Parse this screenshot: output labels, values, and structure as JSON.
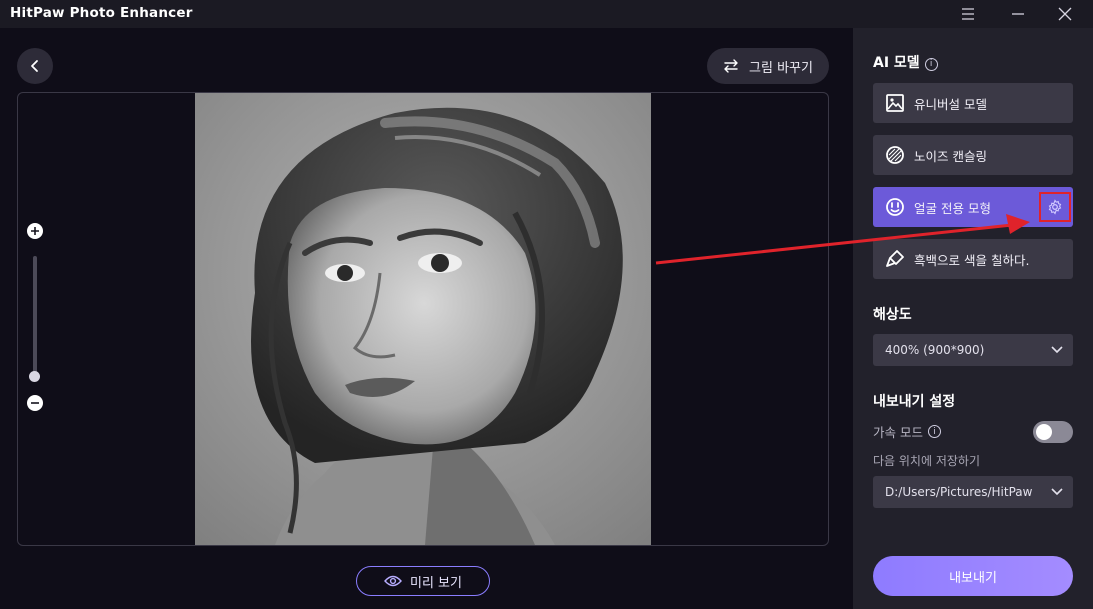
{
  "app": {
    "title": "HitPaw Photo Enhancer"
  },
  "toolbar": {
    "replace_label": "그림 바꾸기"
  },
  "preview": {
    "label": "미리 보기"
  },
  "ai_model": {
    "title": "AI 모델",
    "models": [
      {
        "label": "유니버설 모델",
        "icon": "image-icon",
        "active": false
      },
      {
        "label": "노이즈 캔슬링",
        "icon": "noise-icon",
        "active": false
      },
      {
        "label": "얼굴 전용 모형",
        "icon": "face-icon",
        "active": true
      },
      {
        "label": "흑백으로 색을 칠하다.",
        "icon": "brush-icon",
        "active": false
      }
    ]
  },
  "resolution": {
    "title": "해상도",
    "value": "400% (900*900)"
  },
  "export_settings": {
    "title": "내보내기 설정",
    "accel_label": "가속 모드",
    "accel_on": false,
    "save_location_label": "다음 위치에 저장하기",
    "save_path": "D:/Users/Pictures/HitPaw"
  },
  "export": {
    "label": "내보내기"
  },
  "colors": {
    "accent": "#6c5ad9",
    "export": "#9a85ff",
    "highlight": "#e0232b"
  }
}
